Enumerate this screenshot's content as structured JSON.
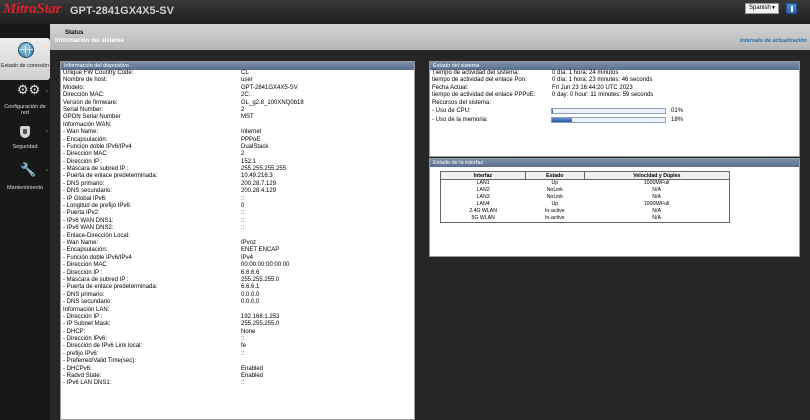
{
  "header": {
    "brand": "MitraStar",
    "model": "GPT-2841GX4X5-SV",
    "language": "Spanish"
  },
  "sidebar": {
    "items": [
      {
        "label": "Estado de conexión",
        "icon": "globe-icon",
        "active": true
      },
      {
        "label": "Configuración de red",
        "icon": "gears-icon"
      },
      {
        "label": "Seguridad",
        "icon": "shield-icon"
      },
      {
        "label": "Mantenimiento",
        "icon": "tools-icon"
      }
    ]
  },
  "status": {
    "title": "Status",
    "subtitle": "Información del sistema",
    "refresh_label": "Intervalo de actualización"
  },
  "device_info": {
    "title": "Información del dispositivo",
    "rows": [
      {
        "k": "Unique FW Country Code:",
        "v": "CL"
      },
      {
        "k": "Nombre de host:",
        "v": "user"
      },
      {
        "k": "Modelo:",
        "v": "GPT-2841GX4X5-SV"
      },
      {
        "k": "Dirección MAC:",
        "v": "2C:"
      },
      {
        "k": "Versión de firmware:",
        "v": "GL_g2.8_100XNQ0b18"
      },
      {
        "k": "Serial Number:",
        "v": "2"
      },
      {
        "k": "GPON Serial Number",
        "v": "MST"
      },
      {
        "k": "Información WAN:",
        "v": ""
      },
      {
        "k": " - Wan Name:",
        "v": "Internet"
      },
      {
        "k": " - Encapsulación:",
        "v": "PPPoE"
      },
      {
        "k": " - Función doble IPv6/IPv4",
        "v": "DualStack"
      },
      {
        "k": " - Dirección MAC",
        "v": "2"
      },
      {
        "k": " - Dirección IP :",
        "v": "152.1"
      },
      {
        "k": " - Máscara de subred IP :",
        "v": "255.255.255.255"
      },
      {
        "k": " - Puerta de enlace predeterminada:",
        "v": "10.49.216.3"
      },
      {
        "k": " - DNS primario:",
        "v": "200.28.7.129"
      },
      {
        "k": " - DNS secundario:",
        "v": "200.28.4.129"
      },
      {
        "k": " - IP Global IPv6:",
        "v": "::"
      },
      {
        "k": " - Longitud de prefijo IPv6:",
        "v": "0"
      },
      {
        "k": " - Puerta IPv2:",
        "v": "::"
      },
      {
        "k": " - IPv6 WAN DNS1:",
        "v": "::"
      },
      {
        "k": " - IPv6 WAN DNS2:",
        "v": "::"
      },
      {
        "k": " - Enlace-Dirección Local:",
        "v": ""
      },
      {
        "k": " - Wan Name:",
        "v": "IPvoz"
      },
      {
        "k": " - Encapsulación:",
        "v": "ENET ENCAP"
      },
      {
        "k": " - Función doble IPv6/IPv4",
        "v": "IPv4"
      },
      {
        "k": " - Dirección MAC",
        "v": "00:00:00:00:00:00"
      },
      {
        "k": " - Dirección IP :",
        "v": "6.6.6.6"
      },
      {
        "k": " - Máscara de subred IP :",
        "v": "255.255.255.0"
      },
      {
        "k": " - Puerta de enlace predeterminada:",
        "v": "6.6.6.1"
      },
      {
        "k": " - DNS primario:",
        "v": "0.0.0.0"
      },
      {
        "k": " - DNS secundario:",
        "v": "0.0.0.0"
      },
      {
        "k": "Información LAN:",
        "v": ""
      },
      {
        "k": " - Dirección IP :",
        "v": "192.168.1.253"
      },
      {
        "k": " - IP Subnet Mask:",
        "v": "255.255.255.0"
      },
      {
        "k": " - DHCP:",
        "v": "None"
      },
      {
        "k": " - Dirección IPv6:",
        "v": "::"
      },
      {
        "k": " - Dirección de IPv6 Link local:",
        "v": "fe"
      },
      {
        "k": " - prefijo IPv6:",
        "v": "::"
      },
      {
        "k": " - Preferred/Valid Time(sec):",
        "v": ""
      },
      {
        "k": " - DHCPv6:",
        "v": "Enabled"
      },
      {
        "k": " - Radvd State:",
        "v": "Enabled"
      },
      {
        "k": " - IPv6 LAN DNS1:",
        "v": "::"
      }
    ]
  },
  "system_status": {
    "title": "Estado del sistema",
    "rows": [
      {
        "k": "Tiempo de actividad del sistema:",
        "v": "0 día: 1 hora: 24 minutos"
      },
      {
        "k": "tiempo de actividad del enlace Pon:",
        "v": "0 día: 1 hora: 23 minutes: 46 seconds"
      },
      {
        "k": "Fecha Actual:",
        "v": "Fri Jun 23 16:44:20 UTC 2023"
      },
      {
        "k": "tiempo de actividad del enlace PPPoE:",
        "v": "0 day: 0 hour: 11 minutes: 59 seconds"
      },
      {
        "k": "Recursos del sistema:",
        "v": ""
      }
    ],
    "cpu_label": " - Uso de CPU:",
    "cpu_pct": "01%",
    "cpu_value": 1,
    "mem_label": " - Uso de la memoria:",
    "mem_pct": "18%",
    "mem_value": 18
  },
  "interface_status": {
    "title": "Estado de la interfaz",
    "headers": [
      "Interfaz",
      "Estado",
      "Velocidad y Dúplex"
    ],
    "rows": [
      [
        "LAN1",
        "Up",
        "1000M/Full"
      ],
      [
        "LAN2",
        "NoLink",
        "N/A"
      ],
      [
        "LAN3",
        "NoLink",
        "N/A"
      ],
      [
        "LAN4",
        "Up",
        "1000M/Full"
      ],
      [
        "2.4G WLAN",
        "In-active",
        "N/A"
      ],
      [
        "5G WLAN",
        "In-active",
        "N/A"
      ]
    ]
  },
  "colors": {
    "brand": "#d8232a",
    "panel_header": "#6a7f9c",
    "link": "#2a6fb0"
  }
}
